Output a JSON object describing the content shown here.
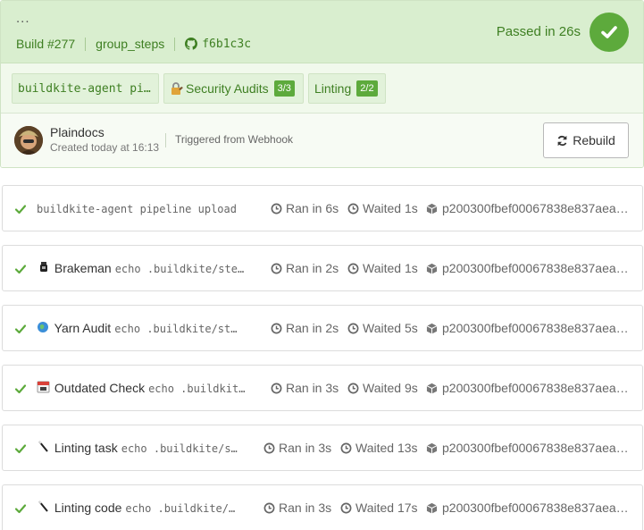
{
  "build": {
    "message": "...",
    "number": "Build #277",
    "branch": "group_steps",
    "commit": "f6b1c3c",
    "status_text": "Passed in 26s"
  },
  "pipeline_chips": [
    {
      "label": "buildkite-agent pi…",
      "count": ""
    },
    {
      "label": "Security Audits",
      "count": "3/3"
    },
    {
      "label": "Linting",
      "count": "2/2"
    }
  ],
  "creator": {
    "name": "Plaindocs",
    "created_at": "Created today at 16:13",
    "triggered": "Triggered from Webhook"
  },
  "rebuild_label": "Rebuild",
  "jobs": [
    {
      "name": "",
      "cmd": "buildkite-agent pipeline upload",
      "ran": "Ran in 6s",
      "waited": "Waited 1s",
      "agent": "p200300fbef00067838e837aea…"
    },
    {
      "name": "Brakeman",
      "cmd": "echo .buildkite/ste…",
      "ran": "Ran in 2s",
      "waited": "Waited 1s",
      "agent": "p200300fbef00067838e837aea…"
    },
    {
      "name": "Yarn Audit",
      "cmd": "echo .buildkite/st…",
      "ran": "Ran in 2s",
      "waited": "Waited 5s",
      "agent": "p200300fbef00067838e837aea…"
    },
    {
      "name": "Outdated Check",
      "cmd": "echo .buildkit…",
      "ran": "Ran in 3s",
      "waited": "Waited 9s",
      "agent": "p200300fbef00067838e837aea…"
    },
    {
      "name": "Linting task",
      "cmd": "echo .buildkite/s…",
      "ran": "Ran in 3s",
      "waited": "Waited 13s",
      "agent": "p200300fbef00067838e837aea…"
    },
    {
      "name": "Linting code",
      "cmd": "echo .buildkite/…",
      "ran": "Ran in 3s",
      "waited": "Waited 17s",
      "agent": "p200300fbef00067838e837aea…"
    }
  ],
  "icons": {
    "status": "check-circle-icon",
    "github": "github-icon",
    "security": "lock-icon",
    "rebuild": "refresh-icon",
    "job_status": "check-icon",
    "clock": "clock-icon",
    "agent": "cube-icon"
  },
  "colors": {
    "success": "#5daa3c",
    "success_text": "#3e7f22",
    "header_bg": "#d9eecf"
  }
}
